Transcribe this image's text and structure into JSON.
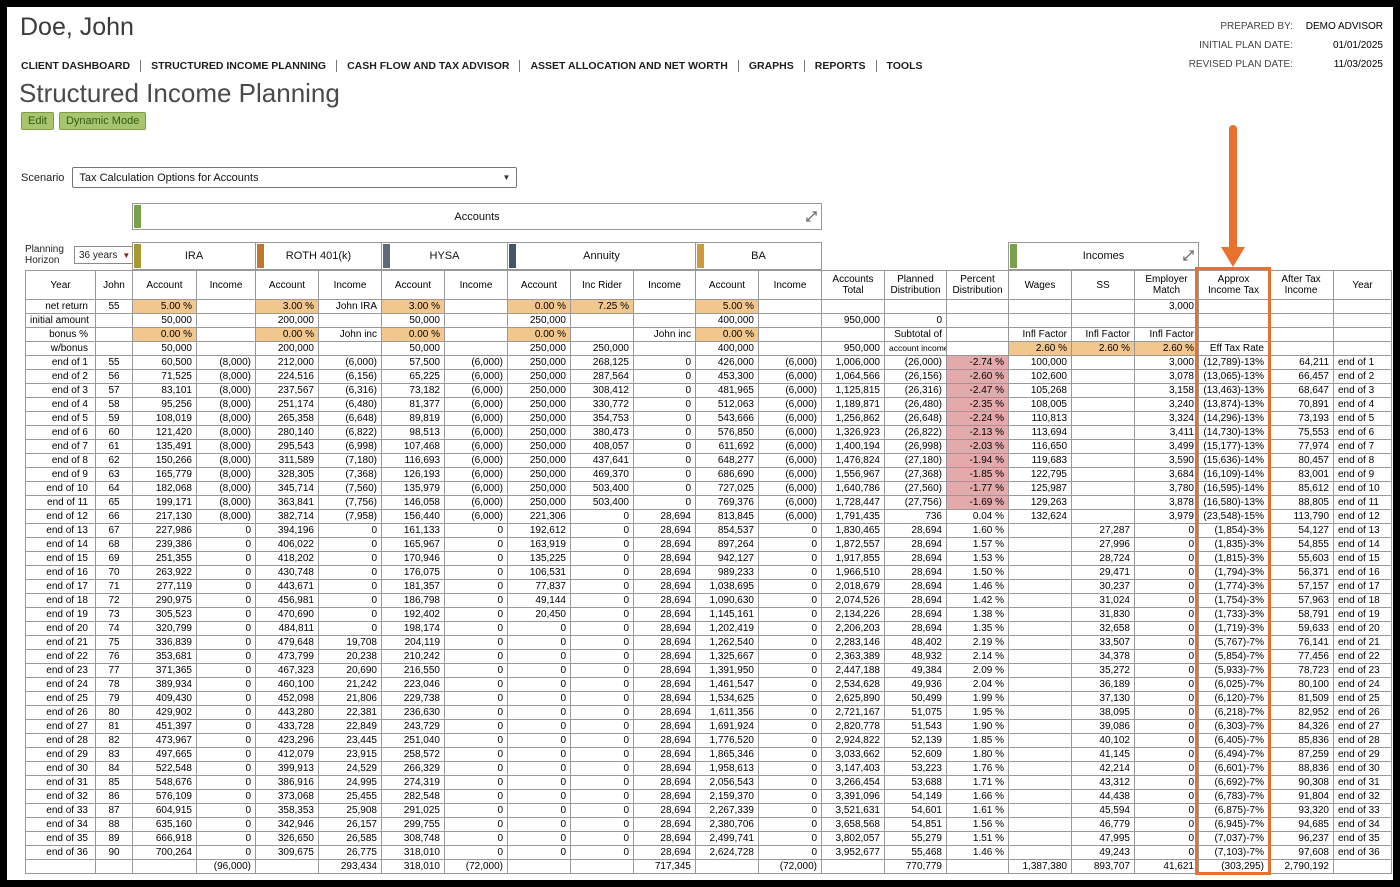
{
  "header": {
    "client_name": "Doe, John",
    "meta": [
      {
        "label": "PREPARED BY:",
        "value": "DEMO ADVISOR"
      },
      {
        "label": "INITIAL PLAN DATE:",
        "value": "01/01/2025"
      },
      {
        "label": "REVISED PLAN DATE:",
        "value": "11/03/2025"
      }
    ]
  },
  "nav": {
    "items": [
      "CLIENT DASHBOARD",
      "STRUCTURED INCOME PLANNING",
      "CASH FLOW AND TAX ADVISOR",
      "ASSET ALLOCATION AND NET WORTH",
      "GRAPHS",
      "REPORTS",
      "TOOLS"
    ]
  },
  "page": {
    "title": "Structured Income Planning",
    "edit_button": "Edit",
    "dynamic_mode_button": "Dynamic Mode",
    "scenario_label": "Scenario",
    "scenario_value": "Tax Calculation Options for Accounts",
    "planning_horizon_label": "Planning Horizon",
    "planning_horizon_value": "36 years"
  },
  "table": {
    "accounts_band": "Accounts",
    "accounts_band_color": "#79a04c",
    "groups": [
      {
        "name": "IRA",
        "color": "#a89a33"
      },
      {
        "name": "ROTH 401(k)",
        "color": "#bf7730"
      },
      {
        "name": "HYSA",
        "color": "#5c6b78"
      },
      {
        "name": "Annuity",
        "color": "#42566b"
      },
      {
        "name": "BA",
        "color": "#cf9a3c"
      },
      {
        "name": "Incomes",
        "color": "#79a04c"
      }
    ],
    "columns": [
      "Year",
      "John",
      "Account",
      "Income",
      "Account",
      "Income",
      "Account",
      "Income",
      "Account",
      "Inc Rider",
      "Income",
      "Account",
      "Income",
      "Accounts Total",
      "Planned Distribution",
      "Percent Distribution",
      "Wages",
      "SS",
      "Employer Match",
      "Approx Income Tax",
      "After Tax Income",
      "Year"
    ],
    "special_rows": [
      [
        "net return",
        "55",
        "5.00 %",
        "",
        "3.00 %",
        "John IRA",
        "3.00 %",
        "",
        "0.00 %",
        "7.25 %",
        "",
        "5.00 %",
        "",
        "",
        "",
        "",
        "",
        "",
        "3,000",
        "",
        "",
        ""
      ],
      [
        "initial amount",
        "",
        "50,000",
        "",
        "200,000",
        "",
        "50,000",
        "",
        "250,000",
        "",
        "",
        "400,000",
        "",
        "950,000",
        "0",
        "",
        "",
        "",
        "",
        "",
        "",
        ""
      ],
      [
        "bonus %",
        "",
        "0.00 %",
        "",
        "0.00 %",
        "John inc",
        "0.00 %",
        "",
        "0.00 %",
        "",
        "John inc",
        "0.00 %",
        "",
        "",
        "Subtotal of",
        "",
        "Infl Factor",
        "Infl Factor",
        "Infl Factor",
        "",
        "",
        ""
      ],
      [
        "w/bonus",
        "",
        "50,000",
        "",
        "200,000",
        "",
        "50,000",
        "",
        "250,000",
        "250,000",
        "",
        "400,000",
        "",
        "950,000",
        "account incomes",
        "",
        "2.60 %",
        "2.60 %",
        "2.60 %",
        "Eff Tax Rate",
        "",
        ""
      ]
    ],
    "rows": [
      [
        "end of 1",
        "55",
        "60,500",
        "(8,000)",
        "212,000",
        "(6,000)",
        "57,500",
        "(6,000)",
        "250,000",
        "268,125",
        "0",
        "426,000",
        "(6,000)",
        "1,006,000",
        "(26,000)",
        "-2.74 %",
        "100,000",
        "",
        "3,000",
        "(12,789)-13%",
        "64,211",
        "end of 1"
      ],
      [
        "end of 2",
        "56",
        "71,525",
        "(8,000)",
        "224,516",
        "(6,156)",
        "65,225",
        "(6,000)",
        "250,000",
        "287,564",
        "0",
        "453,300",
        "(6,000)",
        "1,064,566",
        "(26,156)",
        "-2.60 %",
        "102,600",
        "",
        "3,078",
        "(13,065)-13%",
        "66,457",
        "end of 2"
      ],
      [
        "end of 3",
        "57",
        "83,101",
        "(8,000)",
        "237,567",
        "(6,316)",
        "73,182",
        "(6,000)",
        "250,000",
        "308,412",
        "0",
        "481,965",
        "(6,000)",
        "1,125,815",
        "(26,316)",
        "-2.47 %",
        "105,268",
        "",
        "3,158",
        "(13,463)-13%",
        "68,647",
        "end of 3"
      ],
      [
        "end of 4",
        "58",
        "95,256",
        "(8,000)",
        "251,174",
        "(6,480)",
        "81,377",
        "(6,000)",
        "250,000",
        "330,772",
        "0",
        "512,063",
        "(6,000)",
        "1,189,871",
        "(26,480)",
        "-2.35 %",
        "108,005",
        "",
        "3,240",
        "(13,874)-13%",
        "70,891",
        "end of 4"
      ],
      [
        "end of 5",
        "59",
        "108,019",
        "(8,000)",
        "265,358",
        "(6,648)",
        "89,819",
        "(6,000)",
        "250,000",
        "354,753",
        "0",
        "543,666",
        "(6,000)",
        "1,256,862",
        "(26,648)",
        "-2.24 %",
        "110,813",
        "",
        "3,324",
        "(14,296)-13%",
        "73,193",
        "end of 5"
      ],
      [
        "end of 6",
        "60",
        "121,420",
        "(8,000)",
        "280,140",
        "(6,822)",
        "98,513",
        "(6,000)",
        "250,000",
        "380,473",
        "0",
        "576,850",
        "(6,000)",
        "1,326,923",
        "(26,822)",
        "-2.13 %",
        "113,694",
        "",
        "3,411",
        "(14,730)-13%",
        "75,553",
        "end of 6"
      ],
      [
        "end of 7",
        "61",
        "135,491",
        "(8,000)",
        "295,543",
        "(6,998)",
        "107,468",
        "(6,000)",
        "250,000",
        "408,057",
        "0",
        "611,692",
        "(6,000)",
        "1,400,194",
        "(26,998)",
        "-2.03 %",
        "116,650",
        "",
        "3,499",
        "(15,177)-13%",
        "77,974",
        "end of 7"
      ],
      [
        "end of 8",
        "62",
        "150,266",
        "(8,000)",
        "311,589",
        "(7,180)",
        "116,693",
        "(6,000)",
        "250,000",
        "437,641",
        "0",
        "648,277",
        "(6,000)",
        "1,476,824",
        "(27,180)",
        "-1.94 %",
        "119,683",
        "",
        "3,590",
        "(15,636)-14%",
        "80,457",
        "end of 8"
      ],
      [
        "end of 9",
        "63",
        "165,779",
        "(8,000)",
        "328,305",
        "(7,368)",
        "126,193",
        "(6,000)",
        "250,000",
        "469,370",
        "0",
        "686,690",
        "(6,000)",
        "1,556,967",
        "(27,368)",
        "-1.85 %",
        "122,795",
        "",
        "3,684",
        "(16,109)-14%",
        "83,001",
        "end of 9"
      ],
      [
        "end of 10",
        "64",
        "182,068",
        "(8,000)",
        "345,714",
        "(7,560)",
        "135,979",
        "(6,000)",
        "250,000",
        "503,400",
        "0",
        "727,025",
        "(6,000)",
        "1,640,786",
        "(27,560)",
        "-1.77 %",
        "125,987",
        "",
        "3,780",
        "(16,595)-14%",
        "85,612",
        "end of 10"
      ],
      [
        "end of 11",
        "65",
        "199,171",
        "(8,000)",
        "363,841",
        "(7,756)",
        "146,058",
        "(6,000)",
        "250,000",
        "503,400",
        "0",
        "769,376",
        "(6,000)",
        "1,728,447",
        "(27,756)",
        "-1.69 %",
        "129,263",
        "",
        "3,878",
        "(16,580)-13%",
        "88,805",
        "end of 11"
      ],
      [
        "end of 12",
        "66",
        "217,130",
        "(8,000)",
        "382,714",
        "(7,958)",
        "156,440",
        "(6,000)",
        "221,306",
        "0",
        "28,694",
        "813,845",
        "(6,000)",
        "1,791,435",
        "736",
        "0.04 %",
        "132,624",
        "",
        "3,979",
        "(23,548)-15%",
        "113,790",
        "end of 12"
      ],
      [
        "end of 13",
        "67",
        "227,986",
        "0",
        "394,196",
        "0",
        "161,133",
        "0",
        "192,612",
        "0",
        "28,694",
        "854,537",
        "0",
        "1,830,465",
        "28,694",
        "1.60 %",
        "",
        "27,287",
        "0",
        "(1,854)-3%",
        "54,127",
        "end of 13"
      ],
      [
        "end of 14",
        "68",
        "239,386",
        "0",
        "406,022",
        "0",
        "165,967",
        "0",
        "163,919",
        "0",
        "28,694",
        "897,264",
        "0",
        "1,872,557",
        "28,694",
        "1.57 %",
        "",
        "27,996",
        "0",
        "(1,835)-3%",
        "54,855",
        "end of 14"
      ],
      [
        "end of 15",
        "69",
        "251,355",
        "0",
        "418,202",
        "0",
        "170,946",
        "0",
        "135,225",
        "0",
        "28,694",
        "942,127",
        "0",
        "1,917,855",
        "28,694",
        "1.53 %",
        "",
        "28,724",
        "0",
        "(1,815)-3%",
        "55,603",
        "end of 15"
      ],
      [
        "end of 16",
        "70",
        "263,922",
        "0",
        "430,748",
        "0",
        "176,075",
        "0",
        "106,531",
        "0",
        "28,694",
        "989,233",
        "0",
        "1,966,510",
        "28,694",
        "1.50 %",
        "",
        "29,471",
        "0",
        "(1,794)-3%",
        "56,371",
        "end of 16"
      ],
      [
        "end of 17",
        "71",
        "277,119",
        "0",
        "443,671",
        "0",
        "181,357",
        "0",
        "77,837",
        "0",
        "28,694",
        "1,038,695",
        "0",
        "2,018,679",
        "28,694",
        "1.46 %",
        "",
        "30,237",
        "0",
        "(1,774)-3%",
        "57,157",
        "end of 17"
      ],
      [
        "end of 18",
        "72",
        "290,975",
        "0",
        "456,981",
        "0",
        "186,798",
        "0",
        "49,144",
        "0",
        "28,694",
        "1,090,630",
        "0",
        "2,074,526",
        "28,694",
        "1.42 %",
        "",
        "31,024",
        "0",
        "(1,754)-3%",
        "57,963",
        "end of 18"
      ],
      [
        "end of 19",
        "73",
        "305,523",
        "0",
        "470,690",
        "0",
        "192,402",
        "0",
        "20,450",
        "0",
        "28,694",
        "1,145,161",
        "0",
        "2,134,226",
        "28,694",
        "1.38 %",
        "",
        "31,830",
        "0",
        "(1,733)-3%",
        "58,791",
        "end of 19"
      ],
      [
        "end of 20",
        "74",
        "320,799",
        "0",
        "484,811",
        "0",
        "198,174",
        "0",
        "0",
        "0",
        "28,694",
        "1,202,419",
        "0",
        "2,206,203",
        "28,694",
        "1.35 %",
        "",
        "32,658",
        "0",
        "(1,719)-3%",
        "59,633",
        "end of 20"
      ],
      [
        "end of 21",
        "75",
        "336,839",
        "0",
        "479,648",
        "19,708",
        "204,119",
        "0",
        "0",
        "0",
        "28,694",
        "1,262,540",
        "0",
        "2,283,146",
        "48,402",
        "2.19 %",
        "",
        "33,507",
        "0",
        "(5,767)-7%",
        "76,141",
        "end of 21"
      ],
      [
        "end of 22",
        "76",
        "353,681",
        "0",
        "473,799",
        "20,238",
        "210,242",
        "0",
        "0",
        "0",
        "28,694",
        "1,325,667",
        "0",
        "2,363,389",
        "48,932",
        "2.14 %",
        "",
        "34,378",
        "0",
        "(5,854)-7%",
        "77,456",
        "end of 22"
      ],
      [
        "end of 23",
        "77",
        "371,365",
        "0",
        "467,323",
        "20,690",
        "216,550",
        "0",
        "0",
        "0",
        "28,694",
        "1,391,950",
        "0",
        "2,447,188",
        "49,384",
        "2.09 %",
        "",
        "35,272",
        "0",
        "(5,933)-7%",
        "78,723",
        "end of 23"
      ],
      [
        "end of 24",
        "78",
        "389,934",
        "0",
        "460,100",
        "21,242",
        "223,046",
        "0",
        "0",
        "0",
        "28,694",
        "1,461,547",
        "0",
        "2,534,628",
        "49,936",
        "2.04 %",
        "",
        "36,189",
        "0",
        "(6,025)-7%",
        "80,100",
        "end of 24"
      ],
      [
        "end of 25",
        "79",
        "409,430",
        "0",
        "452,098",
        "21,806",
        "229,738",
        "0",
        "0",
        "0",
        "28,694",
        "1,534,625",
        "0",
        "2,625,890",
        "50,499",
        "1.99 %",
        "",
        "37,130",
        "0",
        "(6,120)-7%",
        "81,509",
        "end of 25"
      ],
      [
        "end of 26",
        "80",
        "429,902",
        "0",
        "443,280",
        "22,381",
        "236,630",
        "0",
        "0",
        "0",
        "28,694",
        "1,611,356",
        "0",
        "2,721,167",
        "51,075",
        "1.95 %",
        "",
        "38,095",
        "0",
        "(6,218)-7%",
        "82,952",
        "end of 26"
      ],
      [
        "end of 27",
        "81",
        "451,397",
        "0",
        "433,728",
        "22,849",
        "243,729",
        "0",
        "0",
        "0",
        "28,694",
        "1,691,924",
        "0",
        "2,820,778",
        "51,543",
        "1.90 %",
        "",
        "39,086",
        "0",
        "(6,303)-7%",
        "84,326",
        "end of 27"
      ],
      [
        "end of 28",
        "82",
        "473,967",
        "0",
        "423,296",
        "23,445",
        "251,040",
        "0",
        "0",
        "0",
        "28,694",
        "1,776,520",
        "0",
        "2,924,822",
        "52,139",
        "1.85 %",
        "",
        "40,102",
        "0",
        "(6,405)-7%",
        "85,836",
        "end of 28"
      ],
      [
        "end of 29",
        "83",
        "497,665",
        "0",
        "412,079",
        "23,915",
        "258,572",
        "0",
        "0",
        "0",
        "28,694",
        "1,865,346",
        "0",
        "3,033,662",
        "52,609",
        "1.80 %",
        "",
        "41,145",
        "0",
        "(6,494)-7%",
        "87,259",
        "end of 29"
      ],
      [
        "end of 30",
        "84",
        "522,548",
        "0",
        "399,913",
        "24,529",
        "266,329",
        "0",
        "0",
        "0",
        "28,694",
        "1,958,613",
        "0",
        "3,147,403",
        "53,223",
        "1.76 %",
        "",
        "42,214",
        "0",
        "(6,601)-7%",
        "88,836",
        "end of 30"
      ],
      [
        "end of 31",
        "85",
        "548,676",
        "0",
        "386,916",
        "24,995",
        "274,319",
        "0",
        "0",
        "0",
        "28,694",
        "2,056,543",
        "0",
        "3,266,454",
        "53,688",
        "1.71 %",
        "",
        "43,312",
        "0",
        "(6,692)-7%",
        "90,308",
        "end of 31"
      ],
      [
        "end of 32",
        "86",
        "576,109",
        "0",
        "373,068",
        "25,455",
        "282,548",
        "0",
        "0",
        "0",
        "28,694",
        "2,159,370",
        "0",
        "3,391,096",
        "54,149",
        "1.66 %",
        "",
        "44,438",
        "0",
        "(6,783)-7%",
        "91,804",
        "end of 32"
      ],
      [
        "end of 33",
        "87",
        "604,915",
        "0",
        "358,353",
        "25,908",
        "291,025",
        "0",
        "0",
        "0",
        "28,694",
        "2,267,339",
        "0",
        "3,521,631",
        "54,601",
        "1.61 %",
        "",
        "45,594",
        "0",
        "(6,875)-7%",
        "93,320",
        "end of 33"
      ],
      [
        "end of 34",
        "88",
        "635,160",
        "0",
        "342,946",
        "26,157",
        "299,755",
        "0",
        "0",
        "0",
        "28,694",
        "2,380,706",
        "0",
        "3,658,568",
        "54,851",
        "1.56 %",
        "",
        "46,779",
        "0",
        "(6,945)-7%",
        "94,685",
        "end of 34"
      ],
      [
        "end of 35",
        "89",
        "666,918",
        "0",
        "326,650",
        "26,585",
        "308,748",
        "0",
        "0",
        "0",
        "28,694",
        "2,499,741",
        "0",
        "3,802,057",
        "55,279",
        "1.51 %",
        "",
        "47,995",
        "0",
        "(7,037)-7%",
        "96,237",
        "end of 35"
      ],
      [
        "end of 36",
        "90",
        "700,264",
        "0",
        "309,675",
        "26,775",
        "318,010",
        "0",
        "0",
        "0",
        "28,694",
        "2,624,728",
        "0",
        "3,952,677",
        "55,468",
        "1.46 %",
        "",
        "49,243",
        "0",
        "(7,103)-7%",
        "97,608",
        "end of 36"
      ]
    ],
    "totals": [
      "",
      "",
      "",
      "(96,000)",
      "",
      "293,434",
      "318,010",
      "(72,000)",
      "",
      "",
      "717,345",
      "",
      "(72,000)",
      "",
      "770,779",
      "",
      "1,387,380",
      "893,707",
      "41,621",
      "(303,295)",
      "2,790,192",
      ""
    ]
  },
  "colors": {
    "highlight_border": "#e8712f",
    "editable_cell": "#f2c78e",
    "negative_distribution": "#e4a9ab",
    "button_green": "#a8c46f"
  }
}
